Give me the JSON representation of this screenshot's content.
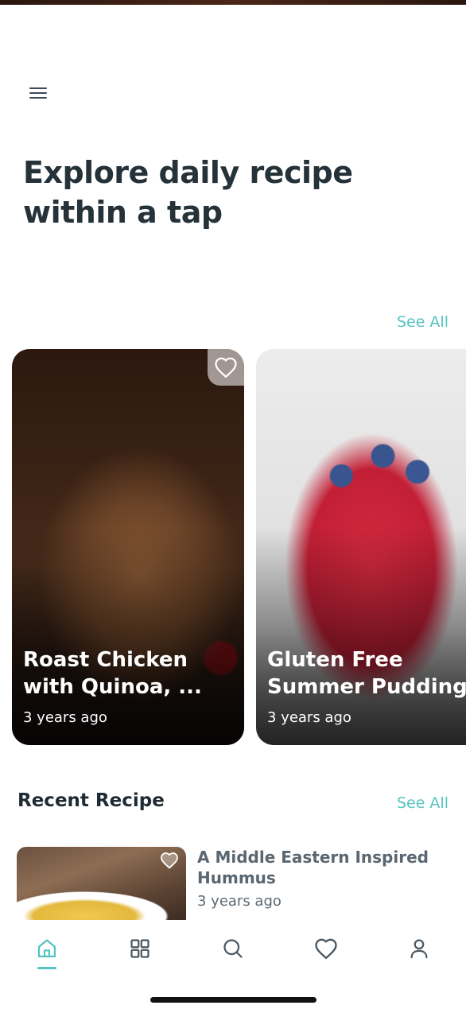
{
  "header": {
    "headline": "Explore daily recipe\nwithin a tap"
  },
  "featured": {
    "see_all_label": "See All",
    "cards": [
      {
        "title": "Roast Chicken\nwith Quinoa, ...",
        "time": "3 years ago",
        "icon": "heart-outline-icon"
      },
      {
        "title": "Gluten Free\nSummer Pudding",
        "time": "3 years ago",
        "icon": "heart-outline-icon"
      }
    ]
  },
  "recent": {
    "section_title": "Recent Recipe",
    "see_all_label": "See All",
    "items": [
      {
        "title": "A Middle Eastern Inspired\nHummus",
        "time": "3 years ago",
        "icon": "heart-outline-icon"
      }
    ]
  },
  "bottom_nav": {
    "items": [
      "home-icon",
      "grid-icon",
      "search-icon",
      "heart-icon",
      "user-icon"
    ],
    "active": "home-icon"
  },
  "colors": {
    "accent": "#55c4c0",
    "text_dark": "#26323a",
    "text_muted": "#5e6a73"
  }
}
